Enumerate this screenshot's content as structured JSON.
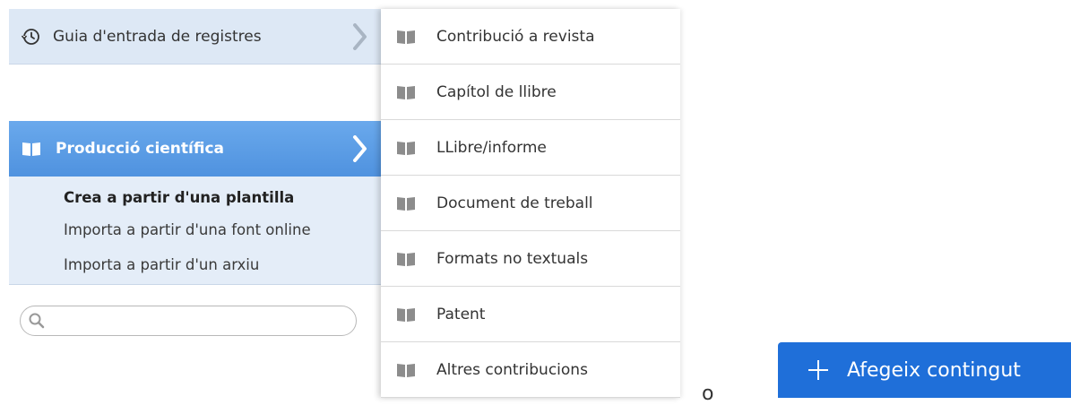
{
  "sidebar": {
    "guide": {
      "label": "Guia d'entrada de registres",
      "icon": "history-icon"
    },
    "production": {
      "label": "Producció científica",
      "icon": "book-icon"
    },
    "submenu": [
      {
        "label": "Crea a partir d'una plantilla",
        "active": true
      },
      {
        "label": "Importa a partir d'una font online",
        "active": false
      },
      {
        "label": "Importa a partir d'un arxiu",
        "active": false
      }
    ],
    "search": {
      "value": "",
      "placeholder": "",
      "icon": "search-icon"
    }
  },
  "dropdown": {
    "items": [
      {
        "label": "Contribució a revista",
        "icon": "book-icon"
      },
      {
        "label": "Capítol de llibre",
        "icon": "book-icon"
      },
      {
        "label": "LLibre/informe",
        "icon": "book-icon"
      },
      {
        "label": "Document de treball",
        "icon": "book-icon"
      },
      {
        "label": "Formats no textuals",
        "icon": "book-icon"
      },
      {
        "label": "Patent",
        "icon": "book-icon"
      },
      {
        "label": "Altres contribucions",
        "icon": "book-icon"
      }
    ]
  },
  "stray_text": "o",
  "add_button": {
    "label": "Afegeix contingut",
    "icon": "plus-icon"
  },
  "colors": {
    "accent": "#4f92df",
    "button": "#1f6fd9",
    "sidebar_bg": "#dde8f5"
  }
}
